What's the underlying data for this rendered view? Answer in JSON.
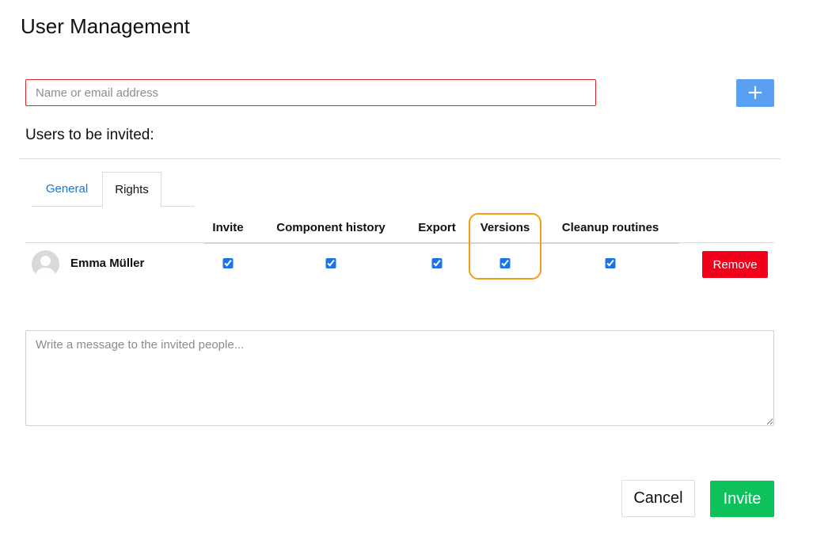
{
  "page": {
    "title": "User Management"
  },
  "search": {
    "placeholder": "Name or email address"
  },
  "add_button": {
    "label": "+",
    "icon": "plus-icon",
    "color": "#5aa0f2"
  },
  "invited": {
    "heading": "Users to be invited:"
  },
  "tabs": [
    {
      "label": "General",
      "active": false
    },
    {
      "label": "Rights",
      "active": true
    }
  ],
  "rights_table": {
    "columns": [
      "Invite",
      "Component history",
      "Export",
      "Versions",
      "Cleanup routines"
    ],
    "highlighted_column": "Versions",
    "rows": [
      {
        "name": "Emma Müller",
        "avatar": "user-avatar-icon",
        "rights": [
          true,
          true,
          true,
          true,
          true
        ],
        "remove_label": "Remove"
      }
    ]
  },
  "message": {
    "placeholder": "Write a message to the invited people..."
  },
  "actions": {
    "cancel": "Cancel",
    "invite": "Invite"
  },
  "colors": {
    "accent": "#1a73d9",
    "remove": "#f0001a",
    "invite": "#0dc15b",
    "highlight": "#f39c12",
    "input_error_border": "#d7262b"
  }
}
